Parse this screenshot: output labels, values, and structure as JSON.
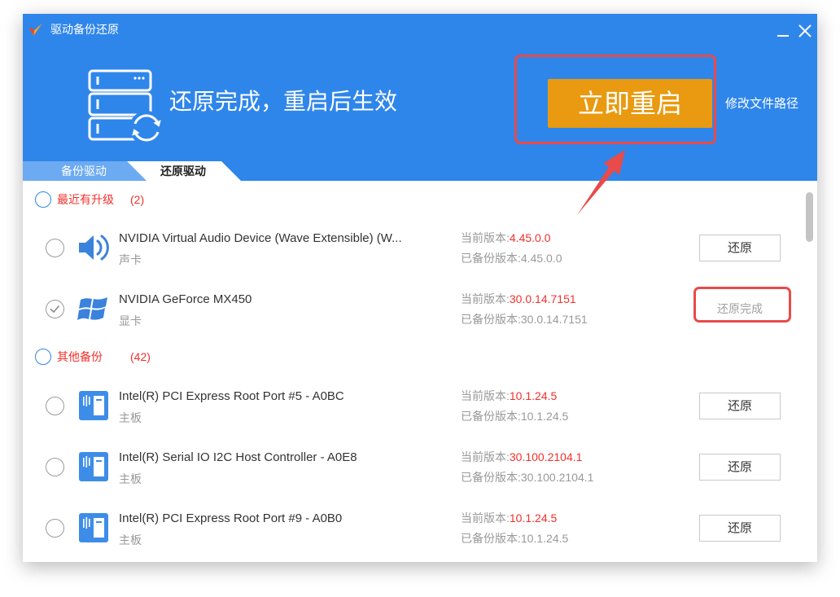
{
  "window": {
    "title": "驱动备份还原",
    "logo_icon": "app-logo-icon",
    "minimize_icon": "minimize-icon",
    "close_icon": "close-icon"
  },
  "header": {
    "status_icon": "server-restore-icon",
    "status_text": "还原完成，重启后生效",
    "restart_button": "立即重启",
    "change_path_link": "修改文件路径"
  },
  "tabs": [
    {
      "label": "备份驱动",
      "active": false
    },
    {
      "label": "还原驱动",
      "active": true
    }
  ],
  "groups": [
    {
      "label": "最近有升级",
      "count": "(2)",
      "items": [
        {
          "icon": "speaker-icon",
          "name": "NVIDIA Virtual Audio Device (Wave Extensible) (W...",
          "category": "声卡",
          "current_label": "当前版本:",
          "current_version": "4.45.0.0",
          "backup_label": "已备份版本:",
          "backup_version": "4.45.0.0",
          "action": "还原",
          "selected": false
        },
        {
          "icon": "windows-logo-icon",
          "name": "NVIDIA GeForce MX450",
          "category": "显卡",
          "current_label": "当前版本:",
          "current_version": "30.0.14.7151",
          "backup_label": "已备份版本:",
          "backup_version": "30.0.14.7151",
          "status": "还原完成",
          "selected": true
        }
      ]
    },
    {
      "label": "其他备份",
      "count": "(42)",
      "items": [
        {
          "icon": "motherboard-icon",
          "name": "Intel(R) PCI Express Root Port #5 - A0BC",
          "category": "主板",
          "current_label": "当前版本:",
          "current_version": "10.1.24.5",
          "backup_label": "已备份版本:",
          "backup_version": "10.1.24.5",
          "action": "还原",
          "selected": false
        },
        {
          "icon": "motherboard-icon",
          "name": "Intel(R) Serial IO I2C Host Controller - A0E8",
          "category": "主板",
          "current_label": "当前版本:",
          "current_version": "30.100.2104.1",
          "backup_label": "已备份版本:",
          "backup_version": "30.100.2104.1",
          "action": "还原",
          "selected": false
        },
        {
          "icon": "motherboard-icon",
          "name": "Intel(R) PCI Express Root Port #9 - A0B0",
          "category": "主板",
          "current_label": "当前版本:",
          "current_version": "10.1.24.5",
          "backup_label": "已备份版本:",
          "backup_version": "10.1.24.5",
          "action": "还原",
          "selected": false
        }
      ]
    }
  ],
  "colors": {
    "header_blue": "#2f86ea",
    "tab_inactive": "#6caaf2",
    "restart_orange": "#e99a10",
    "highlight_red": "#f3302b",
    "annotation_red": "#e94a4a",
    "icon_blue": "#3a82dc"
  }
}
